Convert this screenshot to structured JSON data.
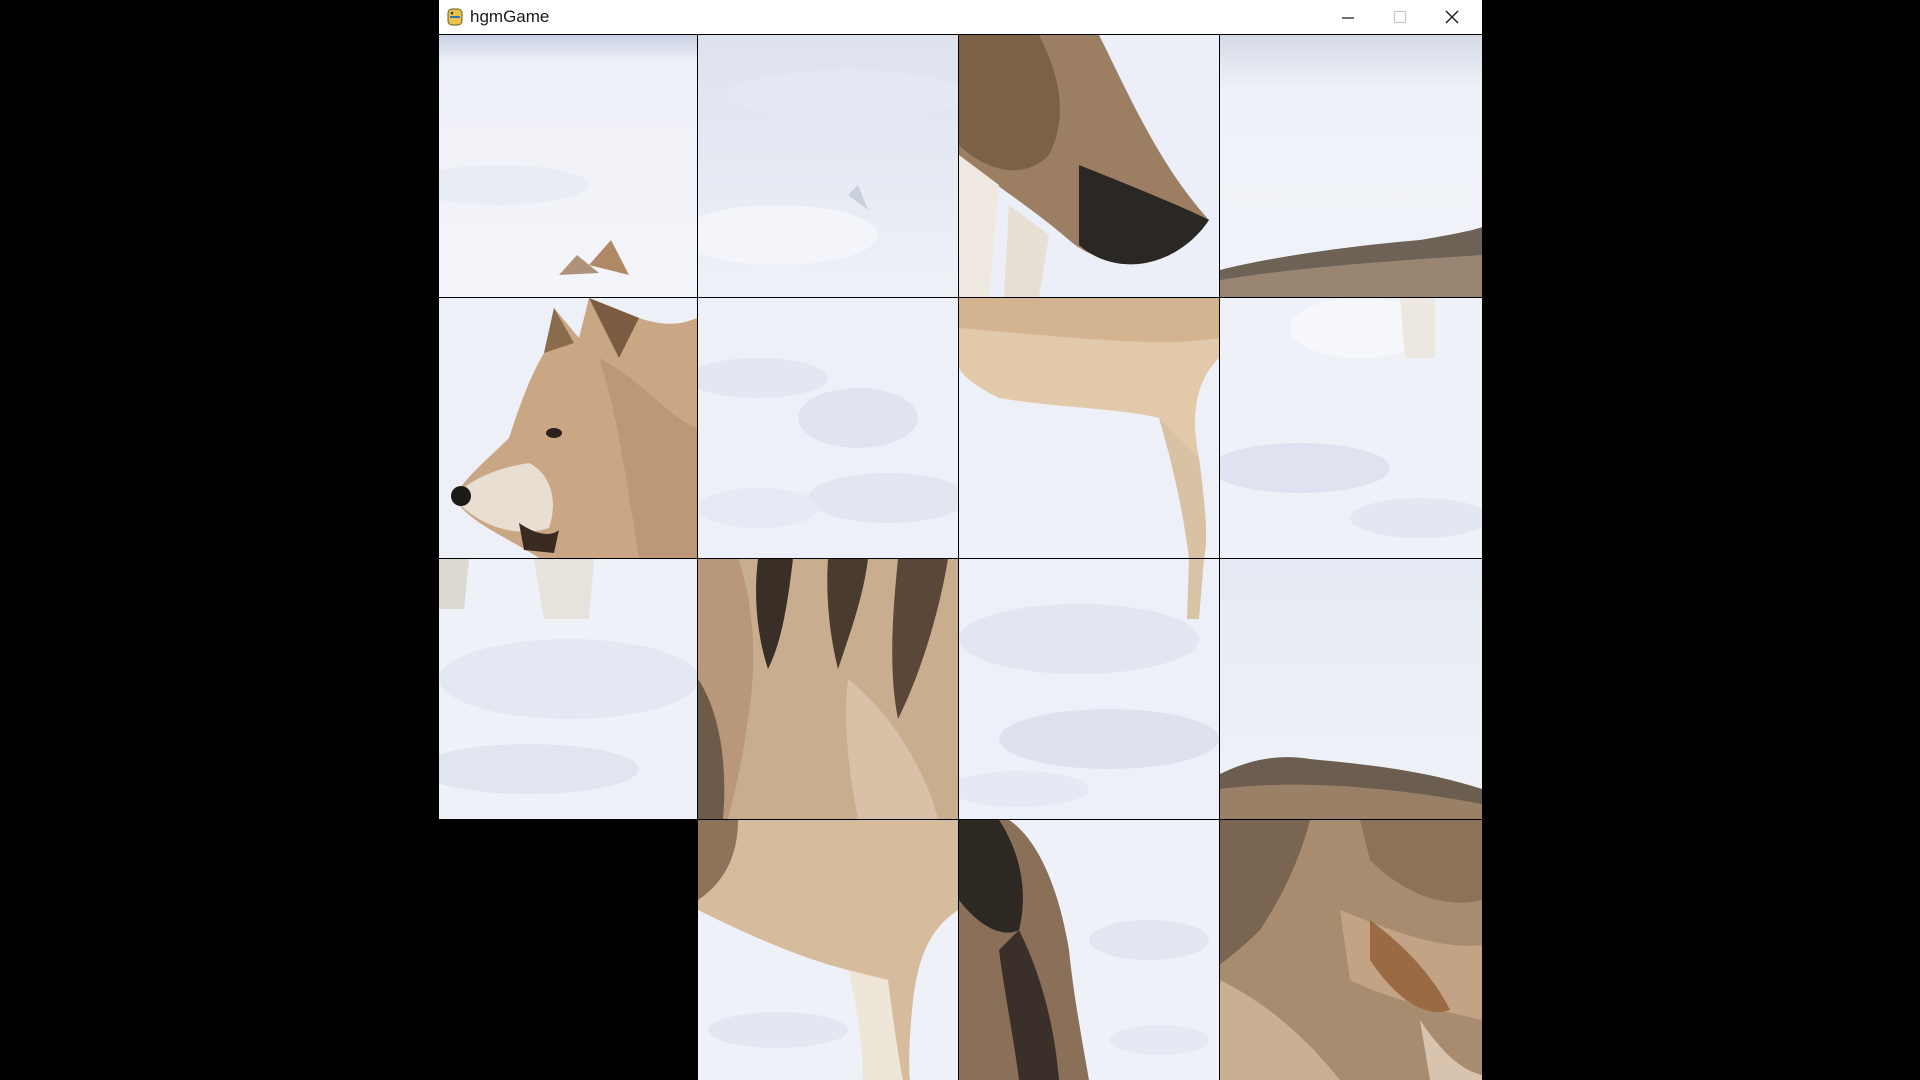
{
  "window": {
    "title": "hgmGame",
    "app_icon": "python-icon"
  },
  "controls": {
    "minimize_icon": "minimize-icon",
    "maximize_icon": "maximize-icon",
    "close_icon": "close-icon"
  },
  "puzzle": {
    "grid": "4x4",
    "blank_tile": {
      "row": 4,
      "col": 1
    },
    "tiles": [
      {
        "row": 1,
        "col": 1,
        "content": "snow"
      },
      {
        "row": 1,
        "col": 2,
        "content": "snow"
      },
      {
        "row": 1,
        "col": 3,
        "content": "wolf-tail"
      },
      {
        "row": 1,
        "col": 4,
        "content": "wolf-back-edge"
      },
      {
        "row": 2,
        "col": 1,
        "content": "wolf-head"
      },
      {
        "row": 2,
        "col": 2,
        "content": "snow"
      },
      {
        "row": 2,
        "col": 3,
        "content": "wolf-hind-leg"
      },
      {
        "row": 2,
        "col": 4,
        "content": "snow"
      },
      {
        "row": 3,
        "col": 1,
        "content": "snow"
      },
      {
        "row": 3,
        "col": 2,
        "content": "wolf-chest"
      },
      {
        "row": 3,
        "col": 3,
        "content": "snow"
      },
      {
        "row": 3,
        "col": 4,
        "content": "wolf-shoulder"
      },
      {
        "row": 4,
        "col": 1,
        "content": "blank"
      },
      {
        "row": 4,
        "col": 2,
        "content": "wolf-foreleg"
      },
      {
        "row": 4,
        "col": 3,
        "content": "wolf-fur"
      },
      {
        "row": 4,
        "col": 4,
        "content": "wolf-body"
      }
    ]
  }
}
